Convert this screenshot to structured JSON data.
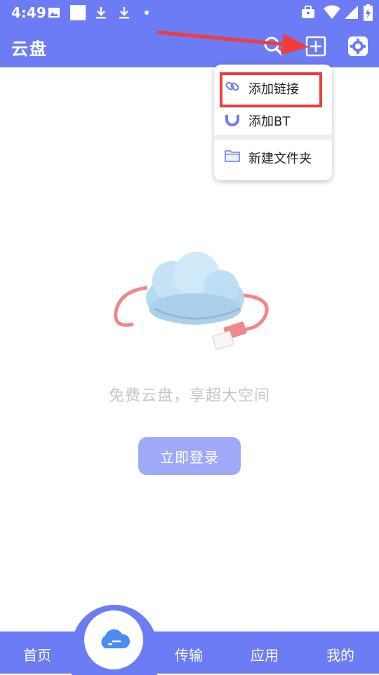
{
  "status_bar": {
    "time": "4:49",
    "left_icons": [
      "image-icon",
      "square-icon",
      "download-icon",
      "download-icon",
      "dot-icon"
    ],
    "right_icons": [
      "briefcase-icon",
      "wifi-icon",
      "signal-icon",
      "battery-icon"
    ]
  },
  "app_bar": {
    "title": "云盘",
    "icons": [
      "search-icon",
      "add-square-icon",
      "gear-icon"
    ]
  },
  "dropdown_menu": {
    "items": [
      {
        "label": "添加链接",
        "icon": "link-icon"
      },
      {
        "label": "添加BT",
        "icon": "magnet-icon"
      },
      {
        "label": "新建文件夹",
        "icon": "folder-icon"
      }
    ],
    "highlight_color": "#f23c3c"
  },
  "main": {
    "tagline": "免费云盘，享超大空间",
    "login_button": "立即登录"
  },
  "bottom_nav": {
    "items": [
      "首页",
      "传输",
      "应用",
      "我的"
    ],
    "center_icon": "cloud-icon"
  },
  "colors": {
    "primary": "#6b7cf5",
    "annotation_red": "#f23c3c"
  }
}
